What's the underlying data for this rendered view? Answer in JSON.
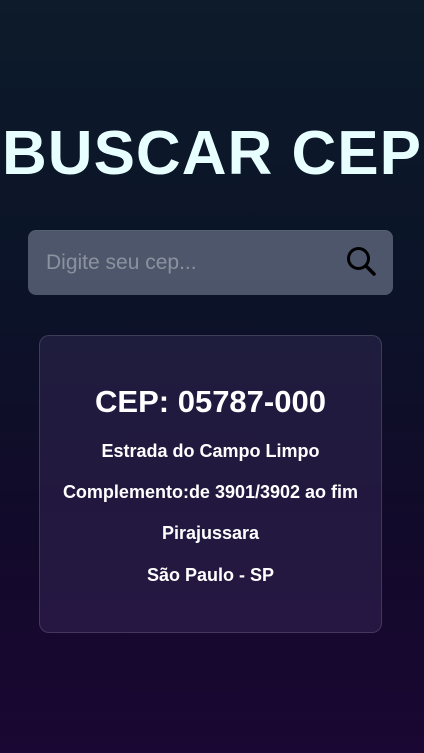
{
  "page": {
    "title": "BUSCAR CEP"
  },
  "search": {
    "placeholder": "Digite seu cep...",
    "value": "",
    "icon": "search-icon"
  },
  "result": {
    "cep_line": "CEP: 05787-000",
    "logradouro": "Estrada do Campo Limpo",
    "complemento": "Complemento:de 3901/3902 ao fim",
    "bairro": "Pirajussara",
    "cidade_uf": "São Paulo - SP"
  },
  "theme": {
    "title_color": "#e8ffff",
    "text_color": "#ffffff"
  }
}
